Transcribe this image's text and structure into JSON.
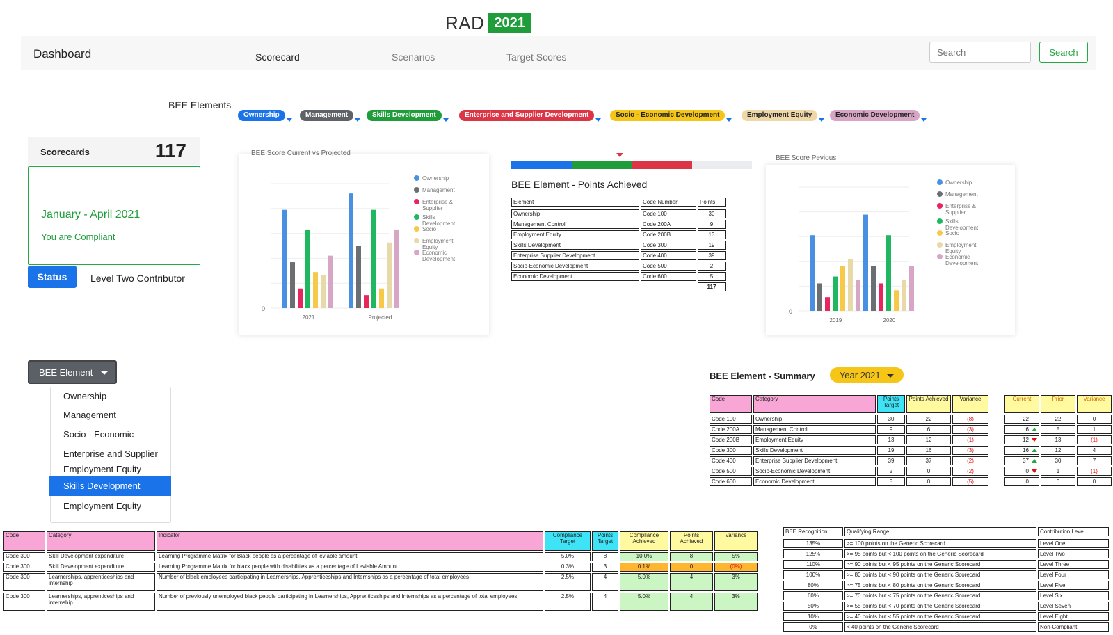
{
  "brand": {
    "name": "RAD",
    "year": "2021"
  },
  "navbar": {
    "title": "Dashboard",
    "links": [
      "Scorecard",
      "Scenarios",
      "Target Scores"
    ],
    "search_placeholder": "Search",
    "search_button": "Search"
  },
  "bee_elements": {
    "label": "BEE Elements",
    "pills": [
      {
        "label": "Ownership",
        "color": "#1a73e8"
      },
      {
        "label": "Management",
        "color": "#5f6368"
      },
      {
        "label": "Skills Development",
        "color": "#1f9d3a"
      },
      {
        "label": "Enterprise and Supplier Development",
        "color": "#dc3545"
      },
      {
        "label": "Socio - Economic Development",
        "color": "#f5c518"
      },
      {
        "label": "Employment Equity",
        "color": "#eed8a8"
      },
      {
        "label": "Economic Development",
        "color": "#d8a6c5"
      }
    ]
  },
  "scorecard": {
    "title": "Scorecards",
    "count": "117",
    "period": "January - April 2021",
    "status_text": "You are Compliant",
    "status_button": "Status",
    "level": "Level Two Contributor"
  },
  "colors": {
    "ownership": "#4a90e2",
    "management": "#6c6f72",
    "enterprise": "#e8265e",
    "skills": "#1fb860",
    "socio": "#f7c948",
    "employment": "#e8d9a8",
    "economic": "#d8a6c5"
  },
  "chart_data": [
    {
      "type": "bar",
      "title": "BEE Score Current vs Projected",
      "categories": [
        "2021",
        "Projected"
      ],
      "series": [
        {
          "name": "Ownership",
          "values": [
            30,
            35
          ]
        },
        {
          "name": "Management",
          "values": [
            14,
            19
          ]
        },
        {
          "name": "Enterprise & Supplier",
          "values": [
            6,
            4
          ]
        },
        {
          "name": "Skills Development",
          "values": [
            24,
            30
          ]
        },
        {
          "name": "Socio",
          "values": [
            11,
            6
          ]
        },
        {
          "name": "Employment Equity",
          "values": [
            10,
            20
          ]
        },
        {
          "name": "Economic Development",
          "values": [
            16,
            24
          ]
        }
      ],
      "ytick": "0",
      "ylim": [
        0,
        38
      ]
    },
    {
      "type": "bar",
      "title": "BEE Score Pevious",
      "categories": [
        "2019",
        "2020"
      ],
      "series": [
        {
          "name": "Ownership",
          "values": [
            22,
            28
          ]
        },
        {
          "name": "Management",
          "values": [
            8,
            13
          ]
        },
        {
          "name": "Enterprise & Supplier",
          "values": [
            4,
            8
          ]
        },
        {
          "name": "Skills Development",
          "values": [
            10,
            22
          ]
        },
        {
          "name": "Socio",
          "values": [
            13,
            6
          ]
        },
        {
          "name": "Employment Equity",
          "values": [
            15,
            9
          ]
        },
        {
          "name": "Economic Development",
          "values": [
            9,
            13
          ]
        }
      ],
      "ytick": "0",
      "ylim": [
        0,
        36
      ]
    }
  ],
  "points_achieved": {
    "title": "BEE Element - Points Achieved",
    "progress": [
      {
        "color": "#1a73e8",
        "fraction": 0.25
      },
      {
        "color": "#1f9d3a",
        "fraction": 0.25
      },
      {
        "color": "#dc3545",
        "fraction": 0.25
      },
      {
        "color": "#eaecef",
        "fraction": 0.25
      }
    ],
    "headers": [
      "Element",
      "Code Number",
      "Points"
    ],
    "rows": [
      [
        "Ownership",
        "Code 100",
        "30"
      ],
      [
        "Management Control",
        "Code 200A",
        "9"
      ],
      [
        "Employment Equity",
        "Code 200B",
        "13"
      ],
      [
        "Skills Development",
        "Code 300",
        "19"
      ],
      [
        "Enterprise Supplier Development",
        "Code 400",
        "39"
      ],
      [
        "Socio-Economic Development",
        "Code 500",
        "2"
      ],
      [
        "Economic Development",
        "Code 600",
        "5"
      ]
    ],
    "total": "117"
  },
  "dropdown": {
    "button": "BEE Element",
    "items": [
      "Ownership",
      "Management",
      "Socio - Economic",
      "Enterprise and Supplier",
      "Employment Equity",
      "Skills Development",
      "Employment Equity"
    ],
    "active_index": 5
  },
  "summary": {
    "title": "BEE Element - Summary",
    "year": "Year 2021",
    "headers": [
      "Code",
      "Category",
      "Points Target",
      "Points Achieved",
      "Variance"
    ],
    "rows": [
      [
        "Code 100",
        "Ownership",
        "30",
        "22",
        "(8)"
      ],
      [
        "Code 200A",
        "Management Control",
        "9",
        "6",
        "(3)"
      ],
      [
        "Code 200B",
        "Employment Equity",
        "13",
        "12",
        "(1)"
      ],
      [
        "Code 300",
        "Skills Development",
        "19",
        "16",
        "(3)"
      ],
      [
        "Code 400",
        "Enterprise Supplier Development",
        "39",
        "37",
        "(2)"
      ],
      [
        "Code 500",
        "Socio-Economic Development",
        "2",
        "0",
        "(2)"
      ],
      [
        "Code 600",
        "Economic Development",
        "5",
        "0",
        "(5)"
      ]
    ],
    "compare_headers": [
      "Current",
      "Prior",
      "Variance"
    ],
    "compare_rows": [
      [
        "22",
        "",
        "22",
        "0"
      ],
      [
        "6",
        "up",
        "5",
        "1"
      ],
      [
        "12",
        "down",
        "13",
        "(1)"
      ],
      [
        "16",
        "up",
        "12",
        "4"
      ],
      [
        "37",
        "up",
        "30",
        "7"
      ],
      [
        "0",
        "down",
        "1",
        "(1)"
      ],
      [
        "0",
        "",
        "0",
        "0"
      ]
    ]
  },
  "skills_table": {
    "headers": [
      "Code",
      "Category",
      "Indicator",
      "Compliance Target",
      "Points Target",
      "Compliance Achieved",
      "Points Achieved",
      "Variance"
    ],
    "rows": [
      [
        "Code 300",
        "Skill Development expenditure",
        "Learning Programme Matrix for Black people as a percentage of leviable amount",
        "5.0%",
        "8",
        "10.0%",
        "8",
        "5%"
      ],
      [
        "Code 300",
        "Skill Development expenditure",
        "Learning Programme Matrix for black people with disabilities as a percentage of Leviable Amount",
        "0.3%",
        "3",
        "0.1%",
        "0",
        "(0%)"
      ],
      [
        "Code 300",
        "Learnerships, apprenticeships and internship",
        "Number of black employees participating in Learnerships, Apprenticeships and Internships as a percentage of total employees",
        "2.5%",
        "4",
        "5.0%",
        "4",
        "3%"
      ],
      [
        "Code 300",
        "Learnerships, apprenticeships and internship",
        "Number of previously unemployed black people participating in Learnerships, Apprenticeships and Internships as a percentage of total employees",
        "2.5%",
        "4",
        "5.0%",
        "4",
        "3%"
      ]
    ]
  },
  "recognition_table": {
    "headers": [
      "BEE Recognition",
      "Qualifying Range",
      "Contribution Level"
    ],
    "rows": [
      [
        "135%",
        ">= 100 points on the Generic Scorecard",
        "Level One"
      ],
      [
        "125%",
        ">= 95 points but < 100 points on the Generic Scorecard",
        "Level Two"
      ],
      [
        "110%",
        ">= 90 points but < 95 points on the Generic Scorecard",
        "Level Three"
      ],
      [
        "100%",
        ">= 80 points but < 90 points on the Generic Scorecard",
        "Level Four"
      ],
      [
        "80%",
        ">= 75 points but < 80 points on the Generic Scorecard",
        "Level Five"
      ],
      [
        "60%",
        ">= 70 points but < 75 points on the Generic Scorecard",
        "Level Six"
      ],
      [
        "50%",
        ">= 55 points but < 70 points on the Generic Scorecard",
        "Level Seven"
      ],
      [
        "10%",
        ">= 40 points but < 55 points on the Generic Scorecard",
        "Level Eight"
      ],
      [
        "0%",
        "< 40 points on the Generic Scorecard",
        "Non-Compliant"
      ]
    ]
  }
}
